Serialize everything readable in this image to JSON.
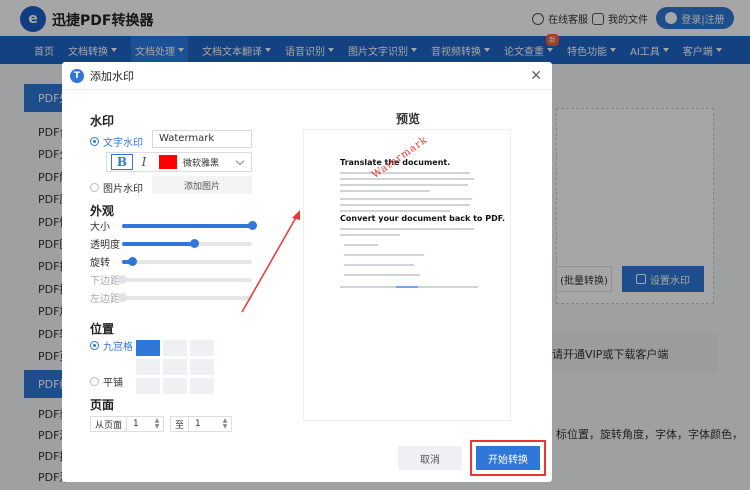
{
  "app": {
    "name": "迅捷PDF转换器",
    "logo_letter": "e"
  },
  "topbar": {
    "service": "在线客服",
    "files": "我的文件",
    "login": "登录|注册"
  },
  "nav": {
    "items": [
      {
        "label": "首页",
        "caret": false,
        "active": false
      },
      {
        "label": "文档转换",
        "caret": true,
        "active": false
      },
      {
        "label": "文档处理",
        "caret": true,
        "active": true
      },
      {
        "label": "文档文本翻译",
        "caret": true,
        "active": false
      },
      {
        "label": "语音识别",
        "caret": true,
        "active": false
      },
      {
        "label": "图片文字识别",
        "caret": true,
        "active": false
      },
      {
        "label": "音视频转换",
        "caret": true,
        "active": false
      },
      {
        "label": "论文查重",
        "caret": true,
        "active": false,
        "badge": "新"
      },
      {
        "label": "特色功能",
        "caret": true,
        "active": false
      },
      {
        "label": "AI工具",
        "caret": true,
        "active": false
      },
      {
        "label": "客户端",
        "caret": true,
        "active": false
      }
    ]
  },
  "background": {
    "side_head_1": "PDF处",
    "side_items_1": [
      "PDF合",
      "PDF分",
      "PDF解",
      "PDF压",
      "PDF快",
      "PDF图",
      "PDF擦",
      "PDF提",
      "PDF加",
      "PDF转",
      "PDF页"
    ],
    "side_head_2": "PDF编",
    "side_items_2": [
      "PDF获",
      "PDF添",
      "PDF提",
      "PDF添"
    ],
    "btn_batch": "(批量转换)",
    "btn_set_watermark": "设置水印",
    "tip": "请开通VIP或下载客户端",
    "desc": "标位置，旋转角度，字体，字体颜色，"
  },
  "modal": {
    "title": "添加水印",
    "watermark_section": "水印",
    "text_watermark": "文字水印",
    "text_value": "Watermark",
    "bold": "B",
    "italic": "I",
    "font_name": "微软雅黑",
    "image_watermark": "图片水印",
    "add_image": "添加图片",
    "appearance_section": "外观",
    "sliders": [
      {
        "label": "大小",
        "value": 1.0,
        "enabled": true
      },
      {
        "label": "透明度",
        "value": 0.55,
        "enabled": true
      },
      {
        "label": "旋转",
        "value": 0.08,
        "enabled": true
      },
      {
        "label": "下边距",
        "value": 0.0,
        "enabled": false
      },
      {
        "label": "左边距",
        "value": 0.0,
        "enabled": false
      }
    ],
    "position_section": "位置",
    "grid_mode": "九宫格",
    "tile_mode": "平铺",
    "page_section": "页面",
    "from_page_label": "从页面",
    "from_page_value": "1",
    "to_label": "至",
    "to_value": "1",
    "preview_title": "预览",
    "preview": {
      "heading1": "Translate the document.",
      "heading2": "Convert your document back to PDF.",
      "watermark_text": "Watermark"
    },
    "cancel": "取消",
    "start": "开始转换"
  },
  "colors": {
    "primary": "#2f77d8",
    "nav": "#1e64c8",
    "highlight": "#e33"
  }
}
